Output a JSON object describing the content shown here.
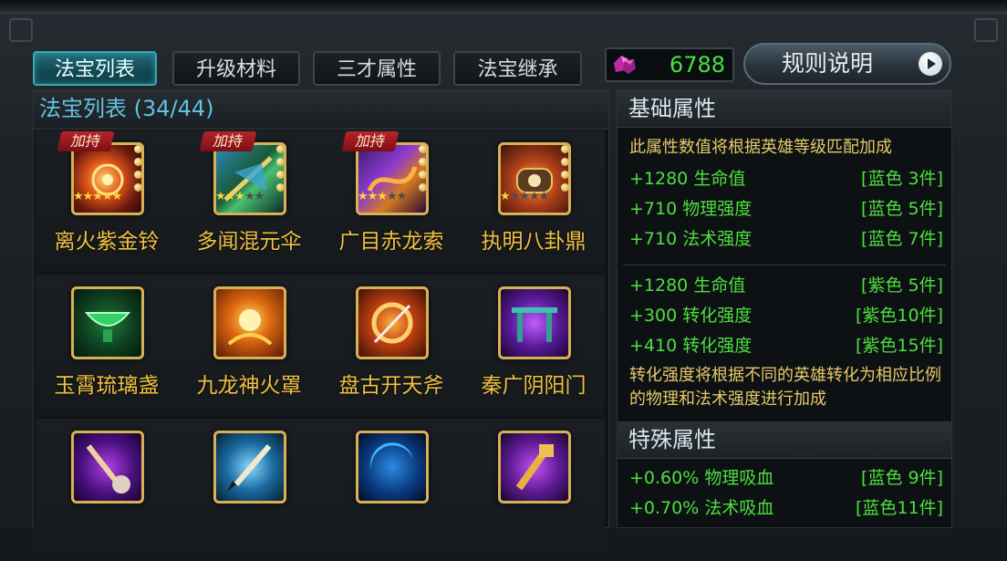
{
  "tabs": [
    {
      "label": "法宝列表",
      "active": true
    },
    {
      "label": "升级材料",
      "active": false
    },
    {
      "label": "三才属性",
      "active": false
    },
    {
      "label": "法宝继承",
      "active": false
    }
  ],
  "currency": {
    "value": "6788",
    "icon": "purple-gem-icon"
  },
  "rules_button": {
    "label": "规则说明"
  },
  "left_panel": {
    "title": "法宝列表 (34/44)",
    "items": [
      {
        "name": "离火紫金铃",
        "badge": "加持",
        "stars": 5,
        "icon": "golden-bell-icon"
      },
      {
        "name": "多闻混元伞",
        "badge": "加持",
        "stars": 3,
        "icon": "umbrella-icon"
      },
      {
        "name": "广目赤龙索",
        "badge": "加持",
        "stars": 3,
        "icon": "dragon-rope-icon"
      },
      {
        "name": "执明八卦鼎",
        "badge": "",
        "stars": 1,
        "icon": "bagua-cauldron-icon"
      },
      {
        "name": "玉霄琉璃盏",
        "badge": "",
        "stars": 0,
        "icon": "jade-cup-icon"
      },
      {
        "name": "九龙神火罩",
        "badge": "",
        "stars": 0,
        "icon": "fire-cover-icon"
      },
      {
        "name": "盘古开天斧",
        "badge": "",
        "stars": 0,
        "icon": "axe-icon"
      },
      {
        "name": "秦广阴阳门",
        "badge": "",
        "stars": 0,
        "icon": "gate-icon"
      },
      {
        "name": "",
        "badge": "",
        "stars": 0,
        "icon": "ruyi-scepter-icon"
      },
      {
        "name": "",
        "badge": "",
        "stars": 0,
        "icon": "brush-icon"
      },
      {
        "name": "",
        "badge": "",
        "stars": 0,
        "icon": "crescent-blade-icon"
      },
      {
        "name": "",
        "badge": "",
        "stars": 0,
        "icon": "golden-club-icon"
      }
    ]
  },
  "right_panel": {
    "basic": {
      "title": "基础属性",
      "desc": "此属性数值将根据英雄等级匹配加成",
      "group1": [
        {
          "stat": "+1280 生命值",
          "req": "[蓝色 3件]"
        },
        {
          "stat": "+710 物理强度",
          "req": "[蓝色 5件]"
        },
        {
          "stat": "+710 法术强度",
          "req": "[蓝色 7件]"
        }
      ],
      "group2": [
        {
          "stat": "+1280 生命值",
          "req": "[紫色 5件]"
        },
        {
          "stat": "+300 转化强度",
          "req": "[紫色10件]"
        },
        {
          "stat": "+410 转化强度",
          "req": "[紫色15件]"
        }
      ],
      "note": "转化强度将根据不同的英雄转化为相应比例的物理和法术强度进行加成"
    },
    "special": {
      "title": "特殊属性",
      "rows": [
        {
          "stat": "+0.60% 物理吸血",
          "req": "[蓝色 9件]"
        },
        {
          "stat": "+0.70% 法术吸血",
          "req": "[蓝色11件]"
        }
      ]
    }
  },
  "colors": {
    "accent": "#3aa6b3",
    "gold_text": "#f0c040",
    "green_text": "#4cdf3e",
    "blue_title": "#62c2e2"
  }
}
